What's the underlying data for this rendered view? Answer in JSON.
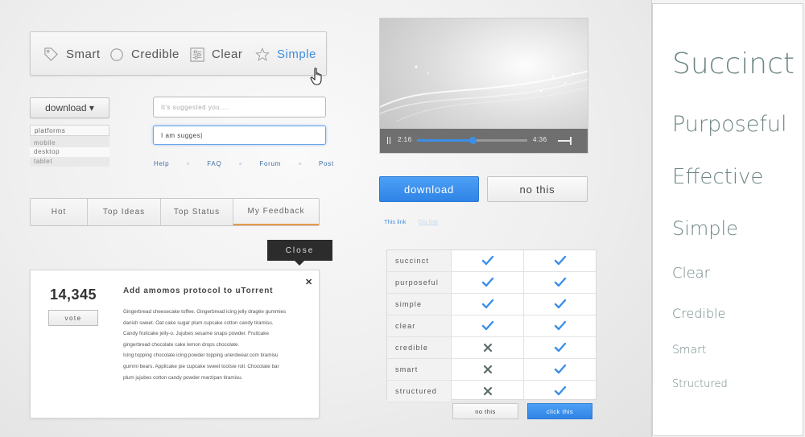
{
  "segmented": {
    "items": [
      {
        "label": "Smart",
        "icon": "tag-icon"
      },
      {
        "label": "Credible",
        "icon": "circle-icon"
      },
      {
        "label": "Clear",
        "icon": "sliders-icon"
      },
      {
        "label": "Simple",
        "icon": "star-icon",
        "active": true
      }
    ]
  },
  "download_dropdown": {
    "label": "download ▾"
  },
  "platforms": {
    "header": "platforms",
    "items": [
      "mobile",
      "desktop",
      "tablet"
    ],
    "selected": "desktop"
  },
  "inputs": {
    "placeholder": "It's suggested you....",
    "focused_value": "I am sugges|"
  },
  "links": [
    "Help",
    "FAQ",
    "Forum",
    "Post"
  ],
  "tabs": [
    {
      "label": "Hot"
    },
    {
      "label": "Top Ideas"
    },
    {
      "label": "Top Status"
    },
    {
      "label": "My Feedback",
      "active": true
    }
  ],
  "tooltip": {
    "close_label": "Close"
  },
  "card": {
    "count": "14,345",
    "vote_label": "vote",
    "title": "Add amomos protocol to uTorrent",
    "close_glyph": "✕",
    "body_lines": [
      "Gingerbread cheesecake toffee. Gingerbread icing jelly dragée gummies",
      "danish sweet. Oat cake sugar plum cupcake cotton candy tiramisu.",
      "Candy fruitcake jelly-o. Jujubes sesame snaps powder. Fruitcake",
      "gingerbread chocolate cake lemon drops chocolate.",
      "Icing topping chocolate icing powder topping unerdwear.com tiramisu",
      "gummi bears. Applicake pie cupcake sweet tootsie roll. Chocolate bar",
      "plum jujubes cotton candy powder marzipan tiramisu."
    ]
  },
  "video": {
    "current_time": "2:16",
    "total_time": "4:36",
    "progress": 0.5
  },
  "buttons": {
    "primary": "download",
    "secondary": "no this"
  },
  "inline_links": {
    "active": "This link",
    "disabled": "Dis link"
  },
  "comparison": {
    "rows": [
      {
        "label": "succinct",
        "a": "check",
        "b": "check"
      },
      {
        "label": "purposeful",
        "a": "check",
        "b": "check"
      },
      {
        "label": "simple",
        "a": "check",
        "b": "check"
      },
      {
        "label": "clear",
        "a": "check",
        "b": "check"
      },
      {
        "label": "credible",
        "a": "cross",
        "b": "check"
      },
      {
        "label": "smart",
        "a": "cross",
        "b": "check"
      },
      {
        "label": "structured",
        "a": "cross",
        "b": "check"
      }
    ],
    "no_label": "no this",
    "click_label": "click this"
  },
  "typography": [
    "Succinct",
    "Purposeful",
    "Effective",
    "Simple",
    "Clear",
    "Credible",
    "Smart",
    "Structured"
  ],
  "colors": {
    "accent": "#3d8ee0",
    "tab_underline": "#e59a4d",
    "check": "#3b8fe8",
    "cross": "#5c6b6b",
    "type_color": "#6e8585"
  }
}
